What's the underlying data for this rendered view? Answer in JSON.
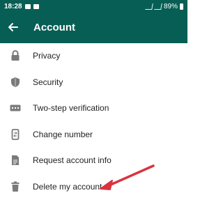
{
  "status_bar": {
    "time": "18:28",
    "battery": "89%"
  },
  "header": {
    "title": "Account",
    "back_icon": "arrow-left-icon"
  },
  "menu": {
    "items": [
      {
        "label": "Privacy",
        "icon": "lock-icon"
      },
      {
        "label": "Security",
        "icon": "shield-icon"
      },
      {
        "label": "Two-step verification",
        "icon": "dots-icon"
      },
      {
        "label": "Change number",
        "icon": "phone-swap-icon"
      },
      {
        "label": "Request account info",
        "icon": "document-icon"
      },
      {
        "label": "Delete my account",
        "icon": "trash-icon"
      }
    ]
  },
  "colors": {
    "primary": "#075e54",
    "icon": "#7a7a7a",
    "annotation": "#d8343f"
  }
}
